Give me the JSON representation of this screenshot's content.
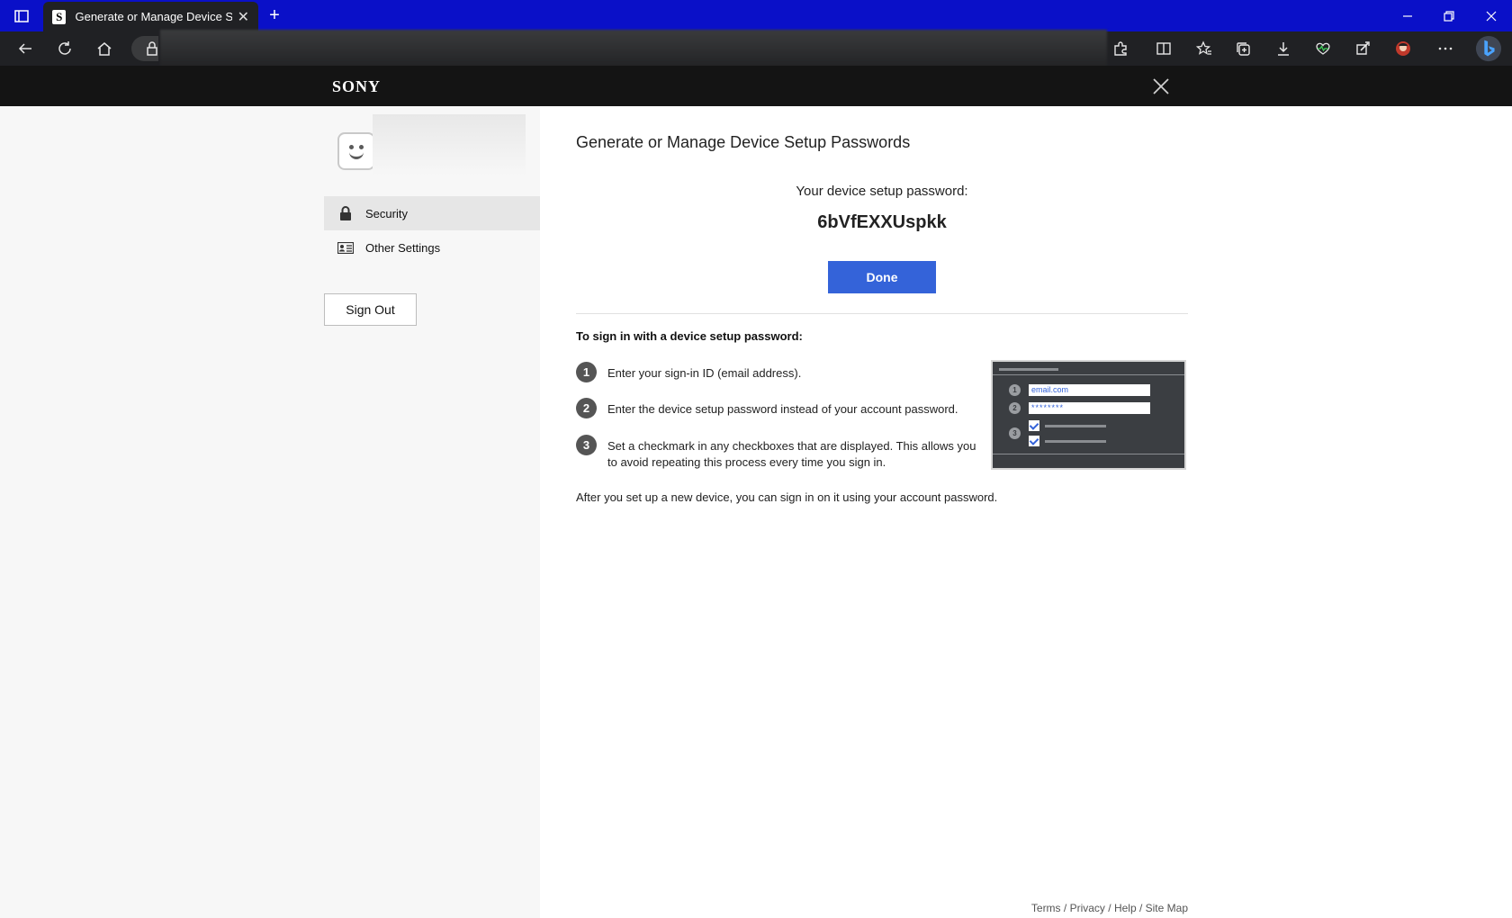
{
  "browser": {
    "tab_title": "Generate or Manage Device Setu",
    "tab_favicon": "S",
    "icons": {
      "sidebar": "sidebar-icon",
      "new_tab": "plus-icon",
      "minimize": "minimize-icon",
      "restore": "restore-icon",
      "close": "close-icon",
      "back": "back-arrow-icon",
      "refresh": "refresh-icon",
      "home": "home-icon",
      "lock": "lock-icon",
      "extensions": "puzzle-icon",
      "split": "split-screen-icon",
      "favorites": "favorites-icon",
      "collections": "collections-icon",
      "downloads": "download-icon",
      "health": "heart-pulse-icon",
      "copilot": "copilot-icon",
      "profile": "profile-avatar",
      "more": "more-icon",
      "bing": "bing-icon"
    }
  },
  "header": {
    "logo": "SONY"
  },
  "sidebar": {
    "items": [
      {
        "label": "Security",
        "icon": "lock-icon",
        "active": true
      },
      {
        "label": "Other Settings",
        "icon": "id-card-icon",
        "active": false
      }
    ],
    "sign_out_label": "Sign Out"
  },
  "main": {
    "title": "Generate or Manage Device Setup Passwords",
    "password_label": "Your device setup password:",
    "password_value": "6bVfEXXUspkk",
    "done_label": "Done",
    "instructions_heading": "To sign in with a device setup password:",
    "steps": [
      {
        "num": "1",
        "text": "Enter your sign-in ID (email address)."
      },
      {
        "num": "2",
        "text": "Enter the device setup password instead of your account password."
      },
      {
        "num": "3",
        "text": "Set a checkmark in any checkboxes that are displayed. This allows you to avoid repeating this process every time you sign in."
      }
    ],
    "illustration": {
      "email_text": "email.com",
      "password_text": "********",
      "nums": [
        "1",
        "2",
        "3"
      ]
    },
    "after_text": "After you set up a new device, you can sign in on it using your account password."
  },
  "footer": {
    "links": [
      "Terms",
      "Privacy",
      "Help",
      "Site Map"
    ],
    "separator": " / "
  },
  "colors": {
    "tabbar": "#0a10c8",
    "toolbar": "#202124",
    "sony_header": "#141414",
    "primary_button": "#3463d9",
    "sidebar_bg": "#f7f7f7"
  }
}
